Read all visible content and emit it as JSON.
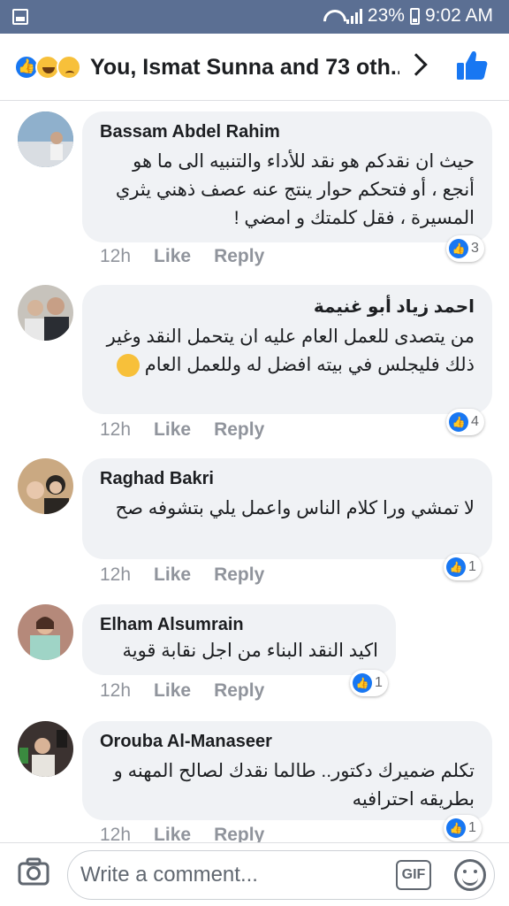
{
  "status_bar": {
    "battery": "23%",
    "time": "9:02 AM"
  },
  "header": {
    "title": "You, Ismat Sunna and 73 oth..."
  },
  "comments": [
    {
      "author": "Bassam Abdel Rahim",
      "text": "حيث ان نقدكم هو نقد للأداء والتنبيه الى ما هو أنجع ، أو فتحكم حوار ينتج عنه عصف ذهني يثري المسيرة ، فقل كلمتك و امضي !",
      "time": "12h",
      "like": "Like",
      "reply": "Reply",
      "reactions": "3"
    },
    {
      "author": "احمد زياد أبو غنيمة",
      "text": "من يتصدى للعمل العام عليه ان يتحمل النقد وغير ذلك فليجلس في بيته افضل له وللعمل العام",
      "time": "12h",
      "like": "Like",
      "reply": "Reply",
      "reactions": "4"
    },
    {
      "author": "Raghad Bakri",
      "text": "لا تمشي ورا كلام الناس واعمل يلي بتشوفه صح",
      "time": "12h",
      "like": "Like",
      "reply": "Reply",
      "reactions": "1"
    },
    {
      "author": "Elham Alsumrain",
      "text": "اكيد النقد البناء من اجل نقابة قوية",
      "time": "12h",
      "like": "Like",
      "reply": "Reply",
      "reactions": "1"
    },
    {
      "author": "Orouba Al-Manaseer",
      "text": "تكلم ضميرك دكتور.. طالما نقدك لصالح المهنه و بطريقه احترافيه",
      "time": "12h",
      "like": "Like",
      "reply": "Reply",
      "reactions": "1"
    }
  ],
  "composer": {
    "placeholder": "Write a comment...",
    "gif_label": "GIF"
  },
  "colors": {
    "status_bar": "#5b6f93",
    "like_blue": "#1877f2",
    "bubble": "#f0f2f5",
    "meta_gray": "#90949c"
  },
  "icons": [
    "gallery-icon",
    "wifi-icon",
    "signal-icon",
    "battery-icon",
    "like-reaction-icon",
    "haha-reaction-icon",
    "sad-reaction-icon",
    "chevron-right-icon",
    "thumbs-up-icon",
    "camera-icon",
    "gif-icon",
    "emoji-icon"
  ]
}
